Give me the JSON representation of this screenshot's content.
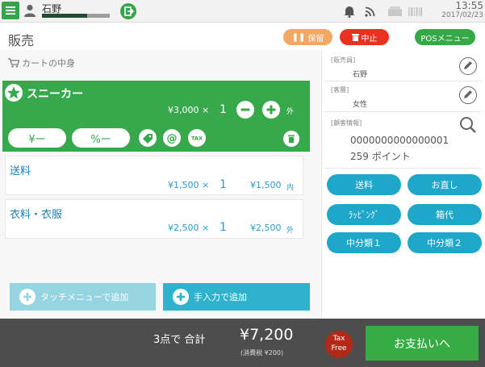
{
  "status_bar": {
    "user_name": "石野",
    "user_progress": 0.67,
    "clock_time": "13:55",
    "clock_date": "2017/02/23"
  },
  "header": {
    "title": "販売",
    "hold_label": "保留",
    "cancel_label": "中止",
    "pos_menu_label": "POSメニュー"
  },
  "cart": {
    "label": "カートの中身",
    "selected_item": {
      "name": "スニーカー",
      "unit_price": "¥3,000 ×",
      "quantity": "1",
      "tax_flag": "外",
      "yen_discount_label": "¥ー",
      "percent_discount_label": "%ー"
    },
    "items": [
      {
        "name": "送料",
        "unit_price": "¥1,500 ×",
        "quantity": "1",
        "total": "¥1,500",
        "tax_flag": "内"
      },
      {
        "name": "衣料・衣服",
        "unit_price": "¥2,500 ×",
        "quantity": "1",
        "total": "¥2,500",
        "tax_flag": "外"
      }
    ],
    "touch_add_label": "タッチメニューで追加",
    "manual_add_label": "手入力で追加"
  },
  "side_panel": {
    "staff_label": "[販売員]",
    "staff_value": "石野",
    "customer_segment_label": "[客層]",
    "customer_segment_value": "女性",
    "customer_info_label": "[顧客情報]",
    "customer_id": "0000000000000001",
    "customer_points": "259 ポイント",
    "buttons": [
      "送料",
      "お直し",
      "ﾗｯﾋﾟﾝｸﾞ",
      "箱代",
      "中分類１",
      "中分類２"
    ]
  },
  "footer": {
    "item_count": "3点で 合計",
    "total": "¥7,200",
    "tax_note": "(消費税 ¥200)",
    "taxfree_line1": "Tax",
    "taxfree_line2": "Free",
    "pay_label": "お支払いへ"
  },
  "colors": {
    "accent_green": "#37a84b",
    "accent_blue": "#1fa7c9",
    "hold_orange": "#f0a864",
    "cancel_red": "#e8321f",
    "footer_dark": "#4d4d4d"
  }
}
